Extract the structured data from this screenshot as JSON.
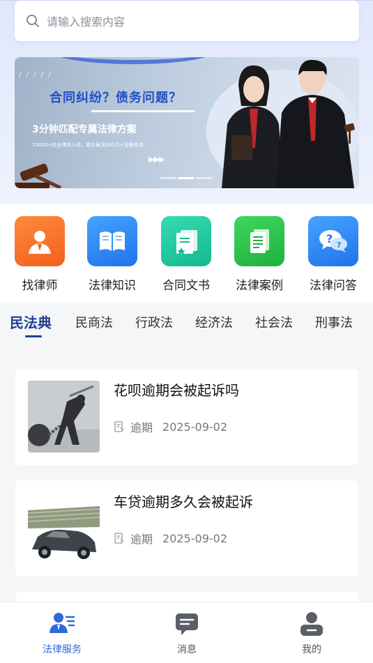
{
  "search": {
    "placeholder": "请输入搜索内容",
    "icon": "search-icon"
  },
  "banner": {
    "slashes": "/ / / / /",
    "title": "合同纠纷？债务问题？",
    "subtitle": "3分钟匹配专属法律方案",
    "small_text": "10000+执业律师入驻，累计解决200万+法律咨询",
    "arrows": "▶▶▶",
    "pages": 3,
    "active_page": 2
  },
  "categories": [
    {
      "label": "找律师",
      "icon": "lawyer-icon",
      "color": "#f5701f"
    },
    {
      "label": "法律知识",
      "icon": "book-icon",
      "color": "#2f86f2"
    },
    {
      "label": "合同文书",
      "icon": "contract-icon",
      "color": "#1fc79c"
    },
    {
      "label": "法律案例",
      "icon": "case-document-icon",
      "color": "#27c24a"
    },
    {
      "label": "法律问答",
      "icon": "qa-chat-icon",
      "color": "#2f86f2"
    }
  ],
  "tabs": [
    "民法典",
    "民商法",
    "行政法",
    "经济法",
    "社会法",
    "刑事法"
  ],
  "articles": [
    {
      "title": "花呗逾期会被起诉吗",
      "tag": "逾期",
      "date": "2025-09-02",
      "image": "chained-man-image"
    },
    {
      "title": "车贷逾期多久会被起诉",
      "tag": "逾期",
      "date": "2025-09-02",
      "image": "car-money-image"
    }
  ],
  "bottom_nav": [
    {
      "label": "法律服务",
      "icon": "legal-service-icon",
      "active": true
    },
    {
      "label": "消息",
      "icon": "message-icon",
      "active": false
    },
    {
      "label": "我的",
      "icon": "profile-icon",
      "active": false
    }
  ],
  "colors": {
    "accent": "#2c6ad8",
    "tab_active": "#1d3f8f"
  }
}
